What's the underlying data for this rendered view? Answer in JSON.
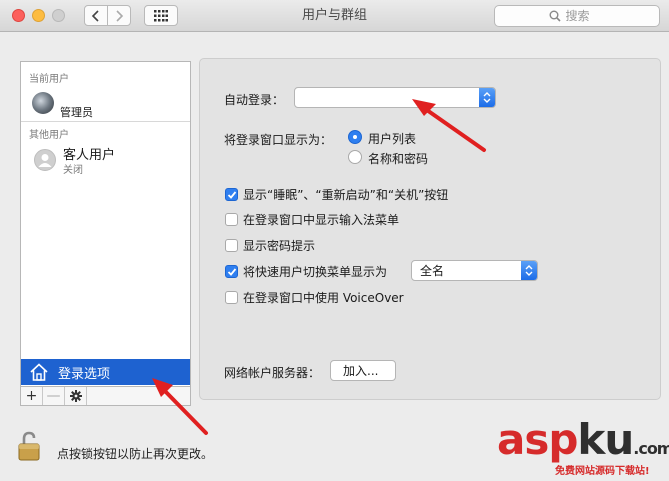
{
  "window": {
    "title": "用户与群组"
  },
  "search": {
    "placeholder": "搜索"
  },
  "sidebar": {
    "current_users_header": "当前用户",
    "admin_name": "管理员",
    "other_users_header": "其他用户",
    "guest_name": "客人用户",
    "guest_status": "关闭",
    "login_options_label": "登录选项",
    "tools": {
      "add": "+",
      "remove": "—"
    }
  },
  "panel": {
    "auto_login_label": "自动登录：",
    "auto_login_value": "",
    "display_as_label": "将登录窗口显示为：",
    "radio_list": "用户列表",
    "radio_name_pw": "名称和密码",
    "cb_sleep": "显示“睡眠”、“重新启动”和“关机”按钮",
    "cb_input_menu": "在登录窗口中显示输入法菜单",
    "cb_pw_hint": "显示密码提示",
    "cb_fast_switch": "将快速用户切换菜单显示为",
    "fast_switch_value": "全名",
    "cb_voiceover": "在登录窗口中使用 VoiceOver",
    "network_label": "网络帐户服务器：",
    "join_button": "加入..."
  },
  "footer": {
    "lock_text": "点按锁按钮以防止再次更改。"
  },
  "watermark": {
    "brand_asp": "asp",
    "brand_ku": "ku",
    "brand_suffix": ".com",
    "sub": "免费网站源码下载站!"
  },
  "colors": {
    "accent": "#2f7ff0",
    "selection": "#1e62d0",
    "annotation_red": "#e02020"
  }
}
